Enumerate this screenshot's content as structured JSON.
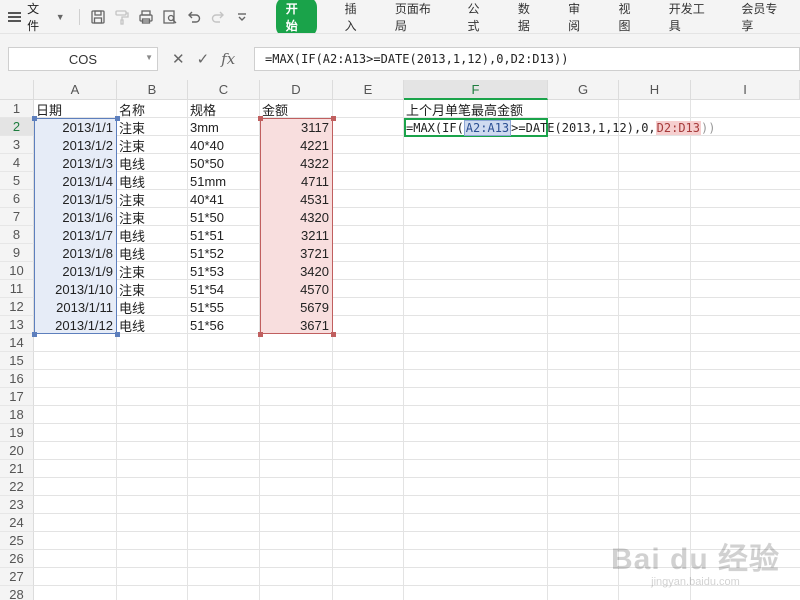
{
  "toolbar": {
    "file_label": "文件",
    "tabs": [
      {
        "label": "开始",
        "active": true
      },
      {
        "label": "插入"
      },
      {
        "label": "页面布局"
      },
      {
        "label": "公式"
      },
      {
        "label": "数据"
      },
      {
        "label": "审阅"
      },
      {
        "label": "视图"
      },
      {
        "label": "开发工具"
      },
      {
        "label": "会员专享"
      }
    ]
  },
  "formula_bar": {
    "name_box": "COS",
    "fx_label": "fx",
    "formula": "=MAX(IF(A2:A13>=DATE(2013,1,12),0,D2:D13))"
  },
  "columns": [
    "A",
    "B",
    "C",
    "D",
    "E",
    "F",
    "G",
    "H",
    "I"
  ],
  "rows": [
    "1",
    "2",
    "3",
    "4",
    "5",
    "6",
    "7",
    "8",
    "9",
    "10",
    "11",
    "12",
    "13",
    "14",
    "15",
    "16",
    "17",
    "18",
    "19",
    "20",
    "21",
    "22",
    "23",
    "24",
    "25",
    "26",
    "27",
    "28"
  ],
  "headers": {
    "date": "日期",
    "name": "名称",
    "spec": "规格",
    "amount": "金额"
  },
  "data_rows": [
    {
      "date": "2013/1/1",
      "name": "注束",
      "spec": "3mm",
      "amount": "3117"
    },
    {
      "date": "2013/1/2",
      "name": "注束",
      "spec": "40*40",
      "amount": "4221"
    },
    {
      "date": "2013/1/3",
      "name": "电线",
      "spec": "50*50",
      "amount": "4322"
    },
    {
      "date": "2013/1/4",
      "name": "电线",
      "spec": "51mm",
      "amount": "4711"
    },
    {
      "date": "2013/1/5",
      "name": "注束",
      "spec": "40*41",
      "amount": "4531"
    },
    {
      "date": "2013/1/6",
      "name": "注束",
      "spec": "51*50",
      "amount": "4320"
    },
    {
      "date": "2013/1/7",
      "name": "电线",
      "spec": "51*51",
      "amount": "3211"
    },
    {
      "date": "2013/1/8",
      "name": "电线",
      "spec": "51*52",
      "amount": "3721"
    },
    {
      "date": "2013/1/9",
      "name": "注束",
      "spec": "51*53",
      "amount": "3420"
    },
    {
      "date": "2013/1/10",
      "name": "注束",
      "spec": "51*54",
      "amount": "4570"
    },
    {
      "date": "2013/1/11",
      "name": "电线",
      "spec": "51*55",
      "amount": "5679"
    },
    {
      "date": "2013/1/12",
      "name": "电线",
      "spec": "51*56",
      "amount": "3671"
    }
  ],
  "f1_label": "上个月单笔最高金额",
  "edit_formula": {
    "part1": "=MAX(IF(",
    "refA": "A2:A13",
    "part2": ">=DATE(2013,1,12),0,",
    "refD": "D2:D13",
    "part3": "))"
  },
  "watermark": {
    "line1": "Bai du 经验",
    "line2": "jingyan.baidu.com"
  }
}
